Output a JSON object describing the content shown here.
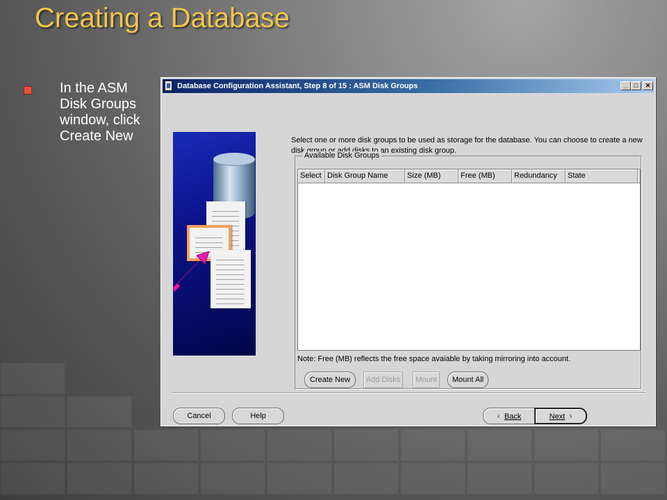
{
  "slide": {
    "title": "Creating a Database",
    "bullet": "In the ASM Disk Groups window, click Create New"
  },
  "window": {
    "title": "Database Configuration Assistant, Step 8 of 15 : ASM Disk Groups",
    "minimize_glyph": "_",
    "maximize_glyph": "□",
    "close_glyph": "✕",
    "description": "Select one or more disk groups to be used as storage for the database. You can choose to create a new disk group or add disks to an existing disk group.",
    "group_title": "Available Disk Groups",
    "table": {
      "columns": [
        "Select",
        "Disk Group Name",
        "Size (MB)",
        "Free (MB)",
        "Redundancy",
        "State"
      ],
      "rows": []
    },
    "note": "Note: Free (MB) reflects the free space avaiable by taking mirroring into account.",
    "group_buttons": {
      "create_new": "Create New",
      "add_disks": "Add Disks",
      "mount": "Mount",
      "mount_all": "Mount All"
    },
    "footer": {
      "cancel": "Cancel",
      "help": "Help",
      "back": "Back",
      "next": "Next",
      "back_icon": "chevron-left-icon",
      "next_icon": "chevron-right-icon"
    }
  }
}
